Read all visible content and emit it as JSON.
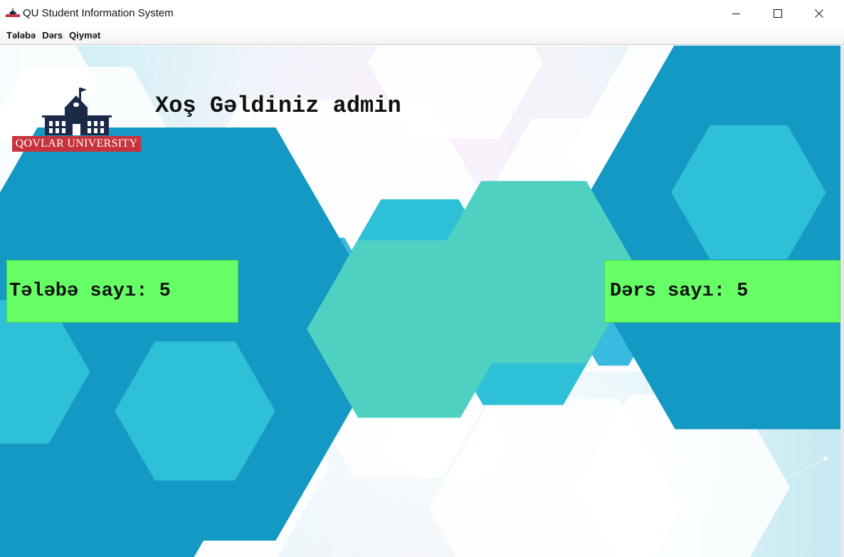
{
  "window": {
    "title": "QU Student Information System",
    "controls": [
      "minimize",
      "maximize",
      "close"
    ]
  },
  "menu": {
    "items": [
      "Tələbə",
      "Dərs",
      "Qiymət"
    ]
  },
  "main": {
    "welcome_text": "Xoş Gəldiniz admin",
    "logo_text": "QOVLAR UNIVERSITY",
    "stats": {
      "students_label": "Tələbə sayı: 5",
      "courses_label": "Dərs sayı: 5"
    }
  },
  "colors": {
    "stat_box": "#66ff66",
    "logo_banner": "#c8333b",
    "logo_building": "#1c2a4a",
    "hex_accent": "#14a5cc"
  },
  "icons": {
    "app": "university-building-icon",
    "minimize": "minimize-icon",
    "maximize": "maximize-icon",
    "close": "close-icon"
  }
}
